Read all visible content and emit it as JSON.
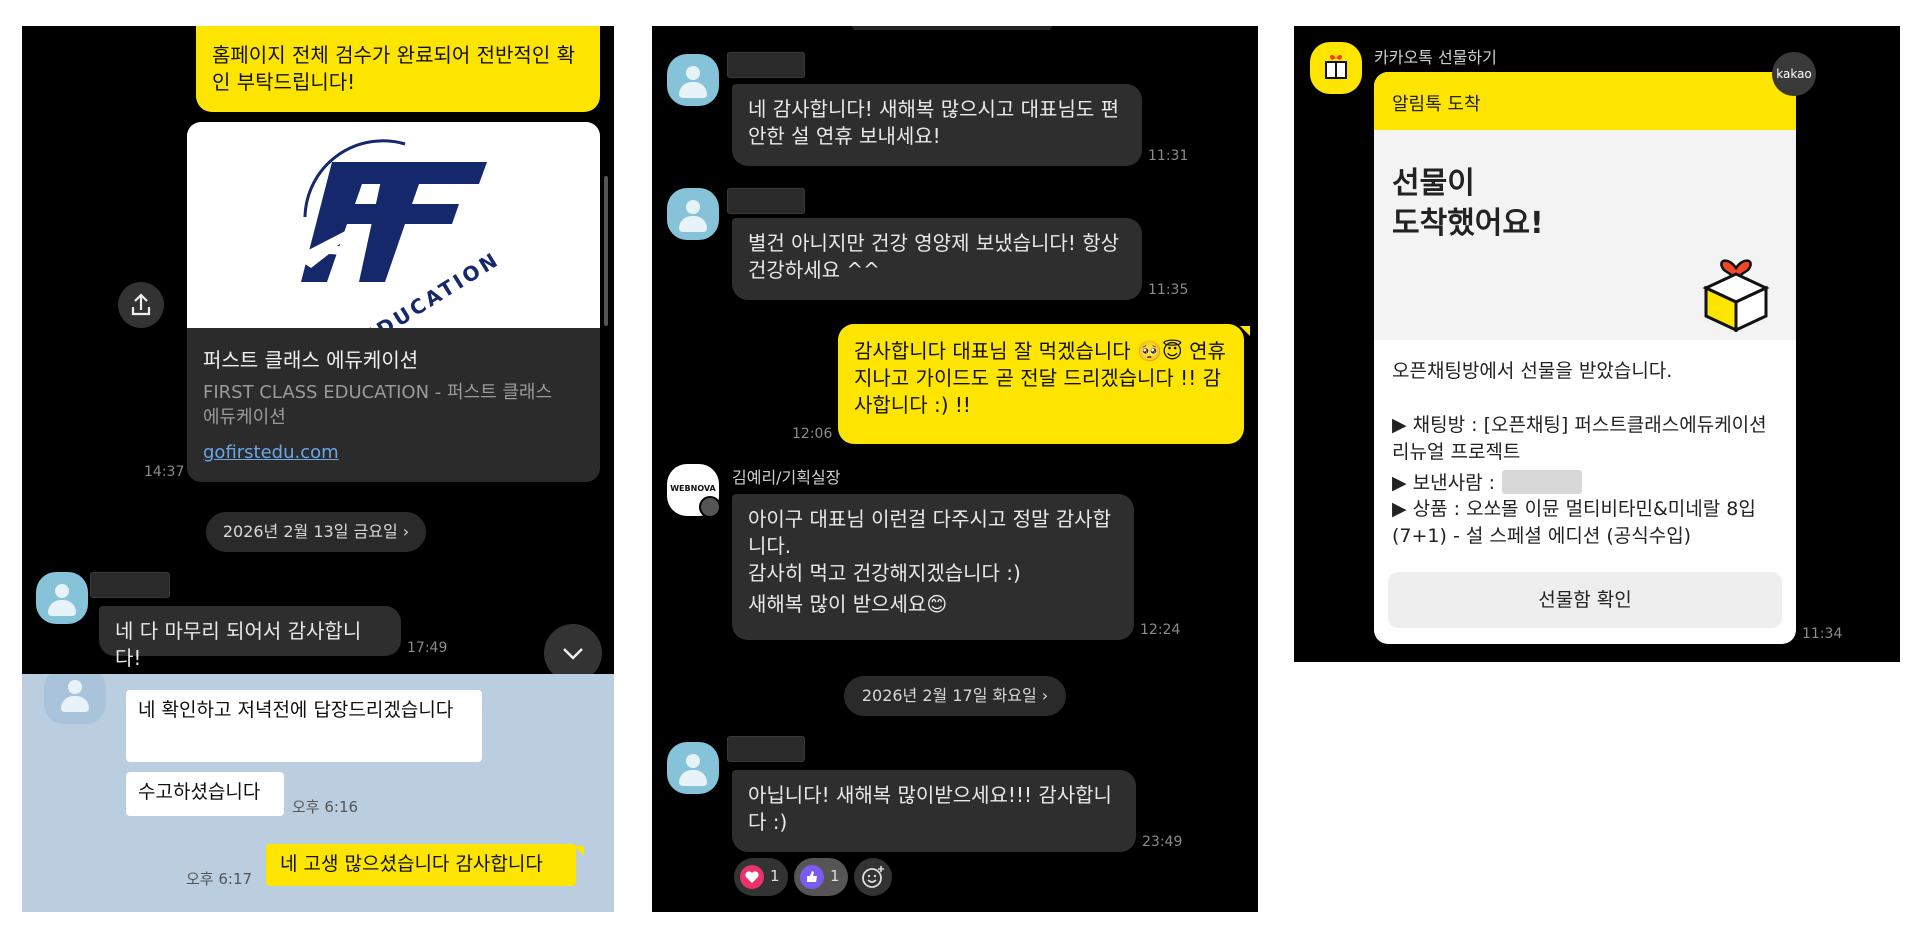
{
  "panel1": {
    "top_bubble": "홈페이지 전체 검수가 완료되어 전반적인 확인 부탁드립니다!",
    "link_card": {
      "logo_text": "EDUCATION",
      "title": "퍼스트 클래스 에듀케이션",
      "description": "FIRST CLASS EDUCATION - 퍼스트 클래스 에듀케이션",
      "url": "gofirstedu.com",
      "time": "14:37"
    },
    "date_divider": "2026년 2월 13일 금요일 ›",
    "received_message": {
      "text": "네 다 마무리 되어서 감사합니다!",
      "time": "17:49"
    }
  },
  "panel1_light": {
    "messages": [
      {
        "text": "네 확인하고 저녁전에 답장드리겠습니다"
      },
      {
        "text": "수고하셨습니다",
        "time": "오후 6:16"
      }
    ],
    "sent": {
      "text": "네 고생 많으셨습니다 감사합니다",
      "time": "오후 6:17"
    }
  },
  "panel2": {
    "msg1": {
      "text": "네 감사합니다! 새해복 많으시고 대표님도 편안한 설 연휴 보내세요!",
      "time": "11:31"
    },
    "msg2": {
      "text": "별건 아니지만 건강 영양제 보냈습니다! 항상 건강하세요 ^^",
      "time": "11:35"
    },
    "sent": {
      "text": "감사합니다 대표님 잘 먹겠습니다 🥺😇 연휴 지나고 가이드도 곧 전달 드리겠습니다 !! 감사합니다 :) !!",
      "time": "12:06"
    },
    "sender_name": "김예리/기획실장",
    "sender_logo": "WEBNOVA",
    "msg3_line1": "아이구 대표님 이런걸 다주시고 정말 감사합니다.",
    "msg3_line2": "감사히 먹고 건강해지겠습니다 :)",
    "msg3_line3": "새해복 많이 받으세요😊",
    "msg3_time": "12:24",
    "date_divider": "2026년 2월 17일 화요일 ›",
    "msg4": {
      "text": "아닙니다! 새해복 많이받으세요!!! 감사합니다 :)",
      "time": "23:49"
    },
    "reactions": [
      {
        "count": "1"
      },
      {
        "count": "1"
      }
    ]
  },
  "panel3": {
    "sender": "카카오톡 선물하기",
    "badge": "kakao",
    "header": "알림톡 도착",
    "headline_1": "선물이",
    "headline_2": "도착했어요!",
    "intro": "오픈채팅방에서 선물을 받았습니다.",
    "room": "▶ 채팅방 : [오픈채팅] 퍼스트클래스에듀케이션 리뉴얼 프로젝트",
    "sender_label": "▶ 보낸사람 :",
    "product": "▶ 상품 : 오쏘몰 이뮨 멀티비타민&미네랄 8입(7+1) - 설 스페셜 에디션 (공식수입)",
    "button": "선물함 확인",
    "time": "11:34"
  },
  "colors": {
    "kakao_yellow": "#fee500",
    "dark_bg": "#000000",
    "bubble_dark": "#2e2e2e",
    "light_bg": "#bacee0"
  },
  "icons": [
    "share-icon",
    "chevron-down-icon",
    "person-icon",
    "heart-icon",
    "thumbs-up-icon",
    "add-reaction-icon",
    "gift-box-icon"
  ]
}
